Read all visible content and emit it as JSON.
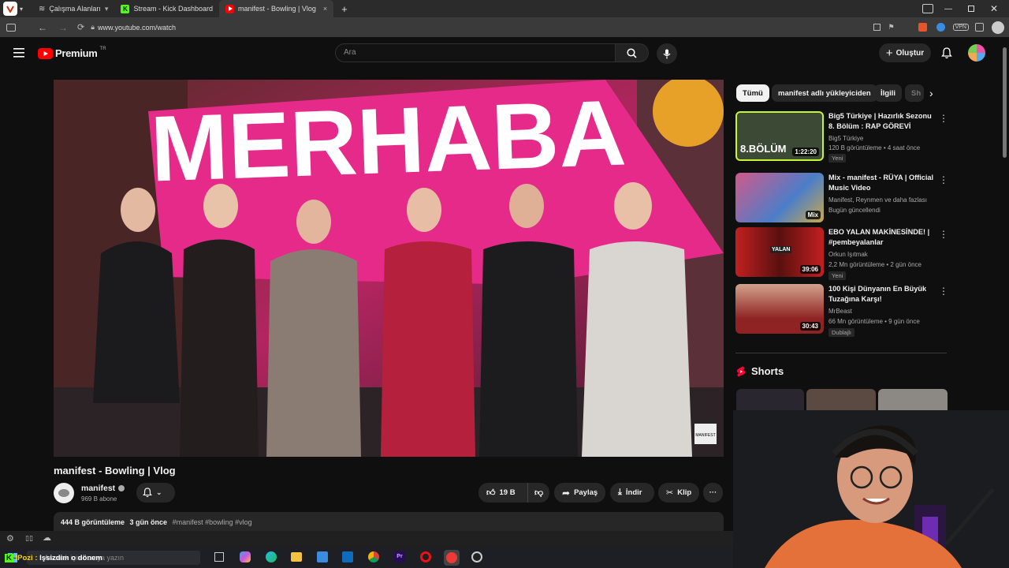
{
  "browser": {
    "tabs": [
      {
        "label": "Çalışma Alanları"
      },
      {
        "label": "Stream - Kick Dashboard"
      },
      {
        "label": "manifest - Bowling | Vlog"
      }
    ],
    "url": "www.youtube.com/watch",
    "vpn_label": "VPN"
  },
  "youtube": {
    "logo_text": "Premium",
    "logo_sup": "TR",
    "search_placeholder": "Ara",
    "create_label": "Oluştur"
  },
  "player": {
    "overlay_text": "MERHABA",
    "watermark": "MANIFEST"
  },
  "chips": [
    {
      "label": "Tümü"
    },
    {
      "label": "manifest adlı yükleyiciden"
    },
    {
      "label": "İlgili"
    },
    {
      "label": "Sh"
    }
  ],
  "recommendations": [
    {
      "title": "Big5 Türkiye | Hazırlık Sezonu 8. Bölüm : RAP GÖREVİ",
      "channel": "Big5 Türkiye",
      "stats": "120 B görüntüleme • 4 saat önce",
      "badge": "Yeni",
      "duration": "1:22:20",
      "thumb_text": "8.BÖLÜM"
    },
    {
      "title": "Mix - manifest - RÜYA | Official Music Video",
      "channel": "Manifest, Reynmen ve daha fazlası",
      "stats": "Bugün güncellendi",
      "badge": "",
      "duration": "Mix",
      "thumb_text": ""
    },
    {
      "title": "EBO YALAN MAKİNESİNDE! | #pembeyalanlar",
      "channel": "Orkun Işıtmak",
      "stats": "2,2 Mn görüntüleme • 2 gün önce",
      "badge": "Yeni",
      "duration": "39:06",
      "thumb_text": "YALAN"
    },
    {
      "title": "100 Kişi Dünyanın En Büyük Tuzağına Karşı!",
      "channel": "MrBeast",
      "stats": "66 Mn görüntüleme • 9 gün önce",
      "badge": "Dublajlı",
      "duration": "30:43",
      "thumb_text": ""
    }
  ],
  "shorts_label": "Shorts",
  "video": {
    "title": "manifest - Bowling | Vlog",
    "channel_name": "manifest",
    "subscribers": "969 B abone",
    "likes": "19 B",
    "share_label": "Paylaş",
    "download_label": "İndir",
    "clip_label": "Klip",
    "views": "444 B görüntüleme",
    "date": "3 gün önce",
    "hashtags": "#manifest #bowling #vlog"
  },
  "taskbar": {
    "search_text": "Aramak için buraya yazın",
    "overlay_caption": "Işsizdim o dönem",
    "overlay_prefix": "IPozi :"
  },
  "colors": {
    "accent_red": "#ff0000",
    "player_pink": "#e62a8a",
    "bg": "#0f0f0f"
  }
}
